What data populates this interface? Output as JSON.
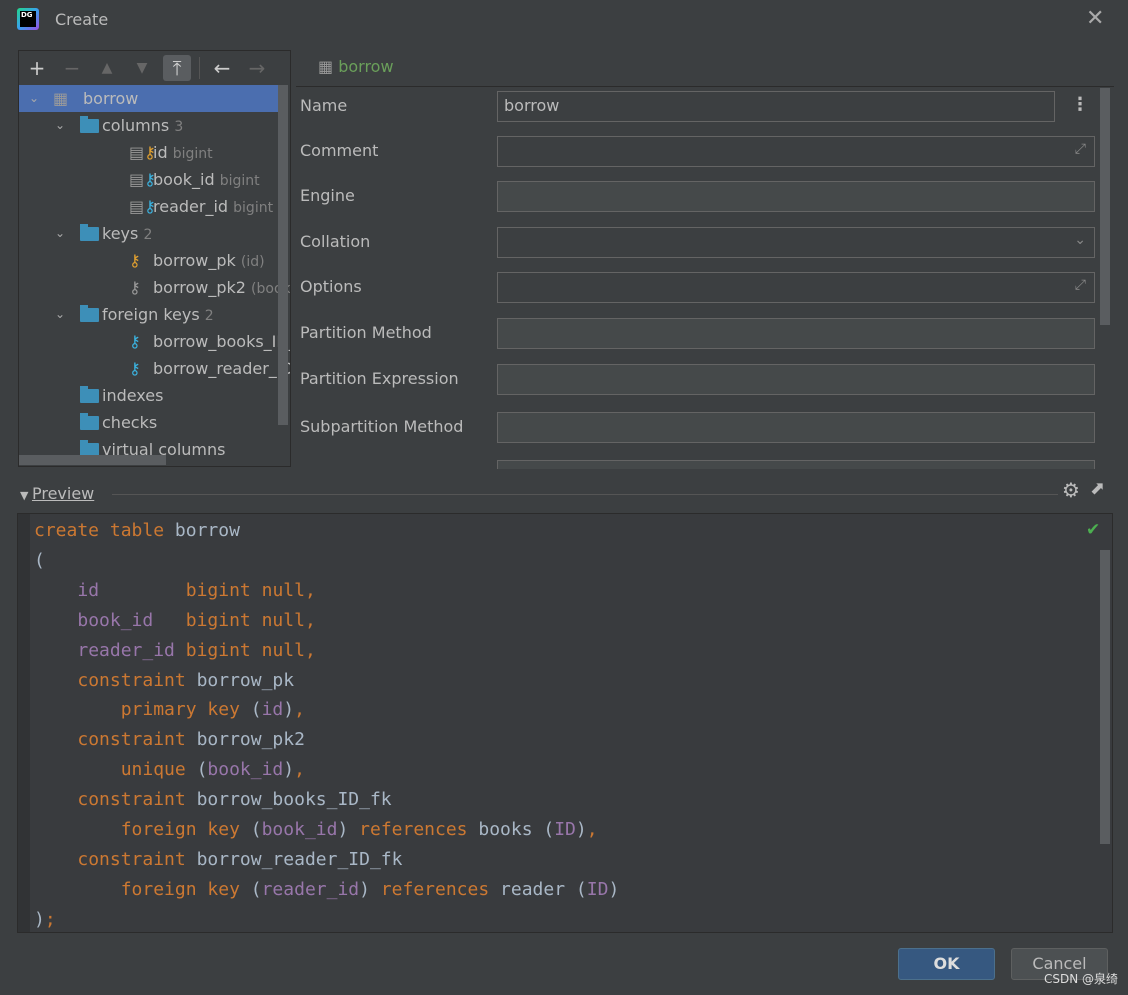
{
  "window": {
    "title": "Create",
    "logo_text": "DG"
  },
  "toolbar": {
    "add": "+",
    "remove": "−",
    "up": "▲",
    "down": "▼",
    "promote": "⤒",
    "back": "←",
    "forward": "→"
  },
  "tree": [
    {
      "label": "borrow",
      "icon": "table-icon",
      "level": 0,
      "expanded": true,
      "selected": true
    },
    {
      "label": "columns",
      "count": "3",
      "icon": "folder-icon",
      "level": 1,
      "expanded": true
    },
    {
      "label": "id",
      "detail": "bigint",
      "icon": "column-pk-icon",
      "level": 2,
      "key_color": "#e0a030"
    },
    {
      "label": "book_id",
      "detail": "bigint",
      "icon": "column-fk-icon",
      "level": 2,
      "key_color": "#3bb3e0"
    },
    {
      "label": "reader_id",
      "detail": "bigint",
      "icon": "column-fk-icon",
      "level": 2,
      "key_color": "#3bb3e0"
    },
    {
      "label": "keys",
      "count": "2",
      "icon": "folder-icon",
      "level": 1,
      "expanded": true
    },
    {
      "label": "borrow_pk",
      "detail": "(id)",
      "icon": "primary-key-icon",
      "level": 2,
      "key_color": "#e0a030"
    },
    {
      "label": "borrow_pk2",
      "detail": "(book_id)",
      "icon": "unique-key-icon",
      "level": 2,
      "key_color": "#999999"
    },
    {
      "label": "foreign keys",
      "count": "2",
      "icon": "folder-icon",
      "level": 1,
      "expanded": true
    },
    {
      "label": "borrow_books_ID_fk",
      "detail": "(",
      "icon": "foreign-key-icon",
      "level": 2,
      "key_color": "#3bb3e0"
    },
    {
      "label": "borrow_reader_ID_fk",
      "detail": "(",
      "icon": "foreign-key-icon",
      "level": 2,
      "key_color": "#3bb3e0"
    },
    {
      "label": "indexes",
      "icon": "folder-icon",
      "level": 1
    },
    {
      "label": "checks",
      "icon": "folder-icon",
      "level": 1
    },
    {
      "label": "virtual columns",
      "icon": "folder-icon",
      "level": 1
    }
  ],
  "details": {
    "header": "borrow",
    "fields": [
      {
        "label": "Name",
        "value": "borrow",
        "kind": "text"
      },
      {
        "label": "Comment",
        "value": "",
        "kind": "expand"
      },
      {
        "label": "Engine",
        "value": "",
        "kind": "disabled"
      },
      {
        "label": "Collation",
        "value": "",
        "kind": "dropdown"
      },
      {
        "label": "Options",
        "value": "",
        "kind": "expand"
      },
      {
        "label": "Partition Method",
        "value": "",
        "kind": "disabled"
      },
      {
        "label": "Partition Expression",
        "value": "",
        "kind": "disabled"
      },
      {
        "label": "Subpartition Method",
        "value": "",
        "kind": "disabled"
      }
    ]
  },
  "preview": {
    "label": "Preview",
    "status": "valid",
    "code": [
      [
        [
          "k",
          "create table "
        ],
        [
          "p",
          "borrow"
        ]
      ],
      [
        [
          "p",
          "("
        ]
      ],
      [
        [
          "p",
          "    "
        ],
        [
          "c",
          "id"
        ],
        [
          "p",
          "        "
        ],
        [
          "k",
          "bigint null,"
        ]
      ],
      [
        [
          "p",
          "    "
        ],
        [
          "c",
          "book_id"
        ],
        [
          "p",
          "   "
        ],
        [
          "k",
          "bigint null,"
        ]
      ],
      [
        [
          "p",
          "    "
        ],
        [
          "c",
          "reader_id"
        ],
        [
          "p",
          " "
        ],
        [
          "k",
          "bigint null,"
        ]
      ],
      [
        [
          "p",
          "    "
        ],
        [
          "k",
          "constraint "
        ],
        [
          "p",
          "borrow_pk"
        ]
      ],
      [
        [
          "p",
          "        "
        ],
        [
          "k",
          "primary key "
        ],
        [
          "p",
          "("
        ],
        [
          "c",
          "id"
        ],
        [
          "p",
          ")"
        ],
        [
          "k",
          ","
        ]
      ],
      [
        [
          "p",
          "    "
        ],
        [
          "k",
          "constraint "
        ],
        [
          "p",
          "borrow_pk2"
        ]
      ],
      [
        [
          "p",
          "        "
        ],
        [
          "k",
          "unique "
        ],
        [
          "p",
          "("
        ],
        [
          "c",
          "book_id"
        ],
        [
          "p",
          ")"
        ],
        [
          "k",
          ","
        ]
      ],
      [
        [
          "p",
          "    "
        ],
        [
          "k",
          "constraint "
        ],
        [
          "p",
          "borrow_books_ID_fk"
        ]
      ],
      [
        [
          "p",
          "        "
        ],
        [
          "k",
          "foreign key "
        ],
        [
          "p",
          "("
        ],
        [
          "c",
          "book_id"
        ],
        [
          "p",
          ") "
        ],
        [
          "k",
          "references "
        ],
        [
          "p",
          "books ("
        ],
        [
          "c",
          "ID"
        ],
        [
          "p",
          ")"
        ],
        [
          "k",
          ","
        ]
      ],
      [
        [
          "p",
          "    "
        ],
        [
          "k",
          "constraint "
        ],
        [
          "p",
          "borrow_reader_ID_fk"
        ]
      ],
      [
        [
          "p",
          "        "
        ],
        [
          "k",
          "foreign key "
        ],
        [
          "p",
          "("
        ],
        [
          "c",
          "reader_id"
        ],
        [
          "p",
          ") "
        ],
        [
          "k",
          "references "
        ],
        [
          "p",
          "reader ("
        ],
        [
          "c",
          "ID"
        ],
        [
          "p",
          ")"
        ]
      ],
      [
        [
          "p",
          ")"
        ],
        [
          "k",
          ";"
        ]
      ]
    ]
  },
  "buttons": {
    "ok": "OK",
    "cancel": "Cancel"
  },
  "watermark": "CSDN @泉绮",
  "colors": {
    "selection": "#4b6eaf",
    "keyword": "#cc7832",
    "column": "#9876aa",
    "header_green": "#6a9f5a",
    "ok_button": "#365880"
  }
}
